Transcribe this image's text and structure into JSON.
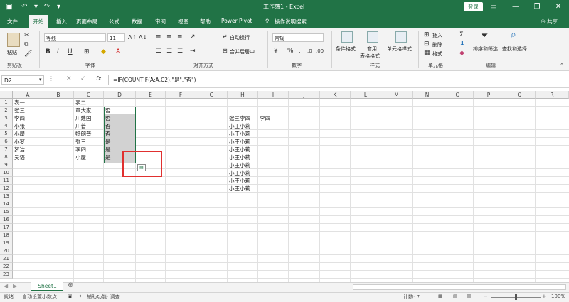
{
  "title_bar": {
    "doc_title": "工作簿1 - Excel",
    "login_label": "登录",
    "quick_access": [
      "save-icon",
      "undo-icon",
      "redo-icon",
      "customize-icon"
    ]
  },
  "tabs": [
    "文件",
    "开始",
    "插入",
    "页面布局",
    "公式",
    "数据",
    "审阅",
    "视图",
    "帮助",
    "Power Pivot"
  ],
  "tell_me": "操作说明搜索",
  "share_label": "共享",
  "ribbon": {
    "clipboard": {
      "paste": "粘贴",
      "group": "剪贴板"
    },
    "font": {
      "name": "等线",
      "size": "11",
      "group": "字体"
    },
    "alignment": {
      "wrap": "自动换行",
      "merge": "合并后居中",
      "group": "对齐方式"
    },
    "number": {
      "format": "常规",
      "group": "数字"
    },
    "styles": {
      "conditional": "条件格式",
      "table_line1": "套用",
      "table_line2": "表格格式",
      "cell_styles": "单元格样式",
      "group": "样式"
    },
    "cells": {
      "insert": "插入",
      "delete": "删除",
      "format": "格式",
      "group": "单元格"
    },
    "editing": {
      "sort": "排序和筛选",
      "find": "查找和选择",
      "group": "编辑"
    }
  },
  "formula_bar": {
    "name_box": "D2",
    "fx": "fx",
    "formula": "=IF(COUNTIF(A:A,C2),\"是\",\"否\")"
  },
  "columns": [
    "A",
    "B",
    "C",
    "D",
    "E",
    "F",
    "G",
    "H",
    "I",
    "J",
    "K",
    "L",
    "M",
    "N",
    "O",
    "P",
    "Q",
    "R"
  ],
  "rows": [
    "1",
    "2",
    "3",
    "4",
    "5",
    "6",
    "7",
    "8",
    "9",
    "10",
    "11",
    "12",
    "13",
    "14",
    "15",
    "16",
    "17",
    "18",
    "19",
    "20",
    "21",
    "22",
    "23"
  ],
  "cells": {
    "A": [
      "表一",
      "张三",
      "李四",
      "小张",
      "小屋",
      "小梦",
      "梦洁",
      "吴语"
    ],
    "C": [
      "表二",
      "章大家",
      "川建国",
      "川普",
      "特朗普",
      "张三",
      "李四",
      "小屋"
    ],
    "D": [
      "",
      "否",
      "否",
      "否",
      "否",
      "是",
      "是",
      "是"
    ],
    "H": [
      "",
      "",
      "张三李四",
      "小王小莉",
      "小王小莉",
      "小王小莉",
      "小王小莉",
      "小王小莉",
      "小王小莉",
      "小王小莉",
      "小王小莉",
      "小王小莉"
    ],
    "I3": "李四"
  },
  "sheet_tab": "Sheet1",
  "status": {
    "ready": "就绪",
    "auto_decimal": "自动设置小数点",
    "accessibility": "辅助功能: 调查",
    "count": "计数: 7",
    "zoom": "100%"
  },
  "colors": {
    "excel_green": "#217346",
    "highlight_red": "#e0302f",
    "selection_fill": "#d2d2d2"
  }
}
